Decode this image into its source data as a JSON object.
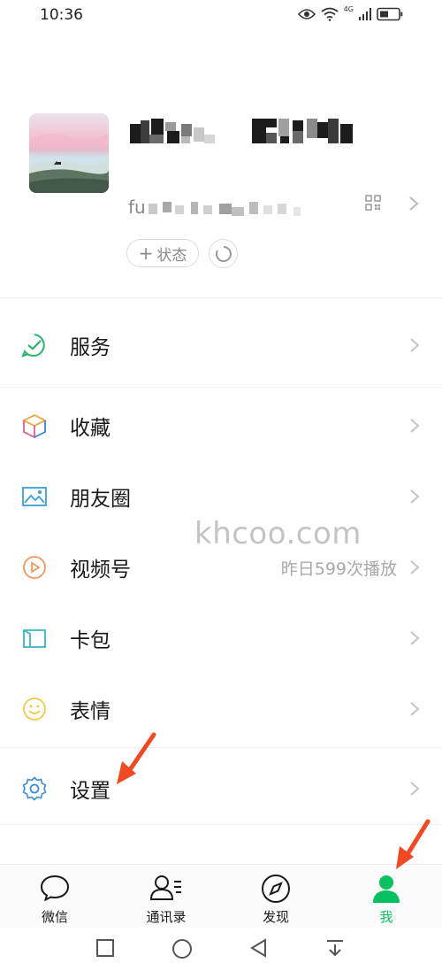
{
  "status_bar": {
    "time": "10:36",
    "network": "4G"
  },
  "profile": {
    "wxid_prefix": "fu",
    "status_button_label": "状态"
  },
  "menu": [
    {
      "label": "服务",
      "icon": "service-icon",
      "value": ""
    },
    {
      "label": "收藏",
      "icon": "favorites-cube-icon",
      "value": ""
    },
    {
      "label": "朋友圈",
      "icon": "moments-picture-icon",
      "value": ""
    },
    {
      "label": "视频号",
      "icon": "channels-play-icon",
      "value": "昨日599次播放"
    },
    {
      "label": "卡包",
      "icon": "card-wallet-icon",
      "value": ""
    },
    {
      "label": "表情",
      "icon": "sticker-smile-icon",
      "value": ""
    },
    {
      "label": "设置",
      "icon": "settings-gear-icon",
      "value": ""
    }
  ],
  "watermark": "khcoo.com",
  "tabbar": {
    "tabs": [
      {
        "label": "微信",
        "icon": "chat-bubble-icon",
        "active": false
      },
      {
        "label": "通讯录",
        "icon": "contacts-icon",
        "active": false
      },
      {
        "label": "发现",
        "icon": "compass-icon",
        "active": false
      },
      {
        "label": "我",
        "icon": "person-icon",
        "active": true
      }
    ]
  },
  "colors": {
    "accent": "#07c160",
    "annotation_arrow": "#f04a24"
  }
}
